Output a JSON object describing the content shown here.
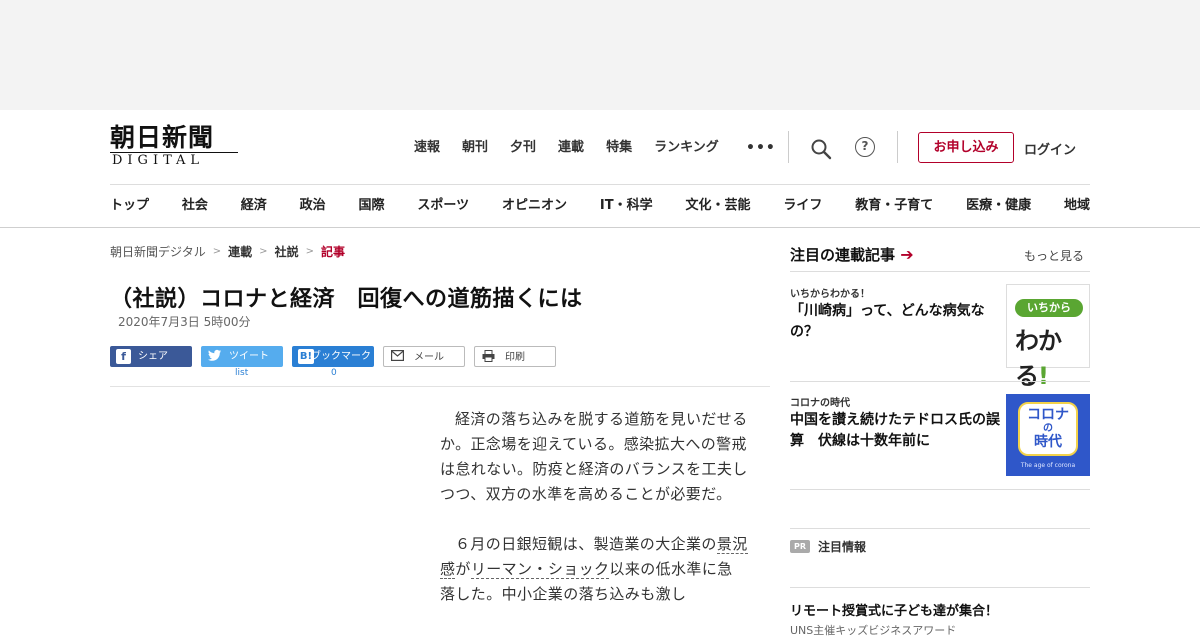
{
  "logo": {
    "jp": "朝日新聞",
    "en": "DIGITAL"
  },
  "topnav": [
    "速報",
    "朝刊",
    "夕刊",
    "連載",
    "特集",
    "ランキング"
  ],
  "more_icon": "•••",
  "help_icon": "?",
  "subscribe_label": "お申し込み",
  "login_label": "ログイン",
  "catnav": [
    "トップ",
    "社会",
    "経済",
    "政治",
    "国際",
    "スポーツ",
    "オピニオン",
    "IT・科学",
    "文化・芸能",
    "ライフ",
    "教育・子育て",
    "医療・健康",
    "地域"
  ],
  "breadcrumb": {
    "home": "朝日新聞デジタル",
    "series": "連載",
    "section": "社説",
    "current": "記事",
    "sep": ">"
  },
  "article": {
    "title": "（社説）コロナと経済　回復への道筋描くには",
    "date": "2020年7月3日 5時00分",
    "para1": "経済の落ち込みを脱する道筋を見いだせるか。正念場を迎えている。感染拡大への警戒は怠れない。防疫と経済のバランスを工夫しつつ、双方の水準を高めることが必要だ。",
    "p2_a": "６月の日銀短観は、製造業の大企業の",
    "p2_link1": "景況感",
    "p2_b": "が",
    "p2_link2": "リーマン・ショック",
    "p2_c": "以来の低水準に急落した。中小企業の落ち込みも激し"
  },
  "share": {
    "facebook": "シェア",
    "twitter": "ツイート",
    "hatena": "ブックマーク",
    "mail": "メール",
    "print": "印刷",
    "twitter_count": "list",
    "hatena_count": "0",
    "facebook_icon": "f",
    "hatena_icon": "B!"
  },
  "sidebar": {
    "heading": "注目の連載記事",
    "arrow": "➔",
    "more": "もっと見る",
    "items": [
      {
        "kicker": "いちからわかる！",
        "title": "「川崎病」って、どんな病気なの？",
        "thumb_top": "いちから",
        "thumb_main": "わかる",
        "thumb_ex": "!"
      },
      {
        "kicker": "コロナの時代",
        "title": "中国を讃え続けたテドロス氏の誤算　伏線は十数年前に",
        "thumb_line1": "コロナ",
        "thumb_line2": "の",
        "thumb_line3": "時代",
        "thumb_small": "The age of corona"
      }
    ],
    "pr_badge": "PR",
    "pr_label": "注目情報",
    "pr_title": "リモート授賞式に子ども達が集合！",
    "pr_sub": "UNS主催キッズビジネスアワード"
  }
}
